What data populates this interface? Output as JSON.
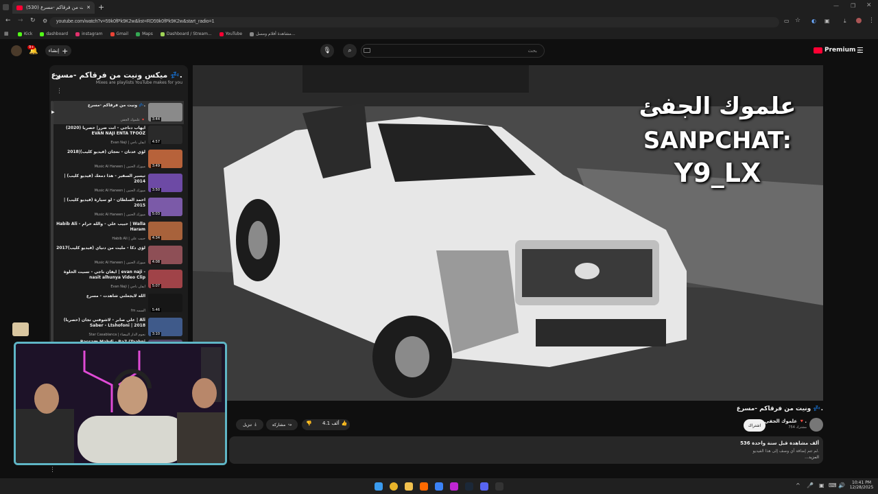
{
  "browser": {
    "tab_title": "(530) ونيت من فرقاكم -مسرع",
    "new_tab": "+",
    "url": "youtube.com/watch?v=59k0fPk9K2w&list=RD59k0fPk9K2w&start_radio=1",
    "bookmarks": [
      {
        "label": "Kick",
        "color": "#53fc18"
      },
      {
        "label": "dashboard",
        "color": "#53fc18"
      },
      {
        "label": "instagram",
        "color": "#e1306c"
      },
      {
        "label": "Gmail",
        "color": "#ea4335"
      },
      {
        "label": "Maps",
        "color": "#34a853"
      },
      {
        "label": "Dashboard / Stream...",
        "color": "#9fd356"
      },
      {
        "label": "YouTube",
        "color": "#ff0033"
      },
      {
        "label": "مشاهدة أفلام ومسل...",
        "color": "#888888"
      }
    ]
  },
  "header": {
    "create_label": "إنشاء",
    "notif_count": "9+",
    "search_placeholder": "بحث",
    "premium_label": "Premium",
    "premium_sup": "JO"
  },
  "playlist": {
    "title": "ميكس ونيت من فرقاكم -مسرع 💤.",
    "subtitle": "Mixes are playlists YouTube makes for you",
    "items": [
      {
        "title": "ونيت من فرقاكم -مسرع 💤.",
        "channel": "علموك الجفي 🔻",
        "duration": "3:44",
        "color": "#8a8a8a"
      },
      {
        "title": "ايهاب دناجي - انت ضرر| حصريا (2020) EVAN NAJI ENTA TFOOZ",
        "channel": "Evan Naji | ايفان ناجي",
        "duration": "4:57",
        "color": "#2a2a2a"
      },
      {
        "title": "لؤي عدنان - نعجان (فيديو كليب)|2018",
        "channel": "Music Al Haneen | ميوزك الحنين",
        "duration": "3:49",
        "color": "#b7623a"
      },
      {
        "title": "تيسير السفير - هذا دمعك (فيديو كليب) | 2014",
        "channel": "Music Al Haneen | ميوزك الحنين",
        "duration": "3:50",
        "color": "#6d4aa5"
      },
      {
        "title": "احمد السلطان - لو سيارة (فيديو كليب) | 2015",
        "channel": "Music Al Haneen | ميوزك الحنين",
        "duration": "5:03",
        "color": "#7b5aa8"
      },
      {
        "title": "Habib Ali - حبيب علي - والله حرام | Walla Haram",
        "channel": "Habib Ali | حبيب علي",
        "duration": "4:34",
        "color": "#a8623b"
      },
      {
        "title": "لؤي دكا - مليت من دنياي (فيديو كليب)2017",
        "channel": "Music Al Haneen | ميوزك الحنين",
        "duration": "4:08",
        "color": "#8e4f56"
      },
      {
        "title": "ايفان ناجي - تسيت الحلوة | evan naji - nasit alhunya Video Clip",
        "channel": "Evan Naji | ايفان ناجي",
        "duration": "5:07",
        "color": "#a04348"
      },
      {
        "title": "الله لايجعلني شاهدت - مسرع",
        "channel": "fm السمه",
        "duration": "5:46",
        "color": "#161616"
      },
      {
        "title": "علي صابر - لاشوفني تجان (حصريا) | Ali Saber - Ltshofoni | 2018",
        "channel": "Star Casablanca | نجوم الدار البيضاء",
        "duration": "3:10",
        "color": "#3f5a8a"
      },
      {
        "title": "Bassam Mahdi - Ra7 (Taabni",
        "channel": "",
        "duration": "",
        "color": "#55466b"
      }
    ]
  },
  "video": {
    "overlay_line1": "علموك الجفئ",
    "overlay_line2": "SANPCHAT:",
    "overlay_line3": "Y9_LX"
  },
  "below": {
    "title": "ونيت من فرقاكم -مسرع 💤.",
    "channel_name": "علموك الجفي 🔻.",
    "subscribers": "754 مشترك",
    "subscribe_label": "اشتراك",
    "like_count": "4.1 ألف",
    "share_label": "مشاركة",
    "download_label": "تنزيل",
    "views": "536 ألف مشاهدة  قبل سنة واحدة",
    "desc_line1": "لم تتم إضافة أي وصف إلى هذا الفيديو.",
    "desc_line2": "...المزيد"
  },
  "taskbar": {
    "time": "10:41 PM",
    "date": "12/28/2025"
  }
}
